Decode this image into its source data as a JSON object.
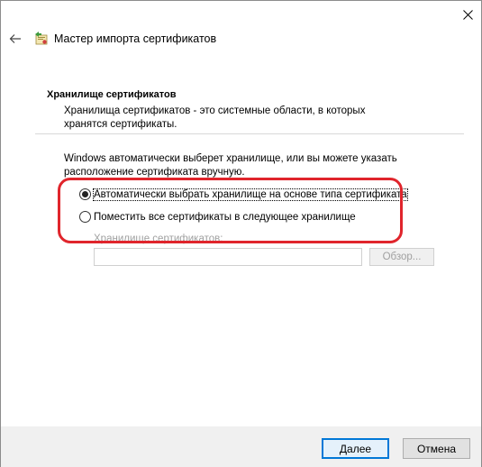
{
  "window": {
    "title": "Мастер импорта сертификатов",
    "close_icon": "close-icon",
    "back_icon": "back-arrow-icon",
    "app_icon": "certificate-wizard-icon"
  },
  "section": {
    "heading": "Хранилище сертификатов",
    "description": "Хранилища сертификатов - это системные области, в которых хранятся сертификаты."
  },
  "intro": "Windows автоматически выберет хранилище, или вы можете указать расположение сертификата вручную.",
  "options": [
    {
      "label": "Автоматически выбрать хранилище на основе типа сертификата",
      "selected": true
    },
    {
      "label": "Поместить все сертификаты в следующее хранилище",
      "selected": false
    }
  ],
  "store": {
    "label": "Хранилище сертификатов:",
    "value": "",
    "browse_label": "Обзор..."
  },
  "buttons": {
    "next_label": "Далее",
    "cancel_label": "Отмена"
  },
  "colors": {
    "highlight": "#e0252c",
    "primary_border": "#0078d7"
  }
}
